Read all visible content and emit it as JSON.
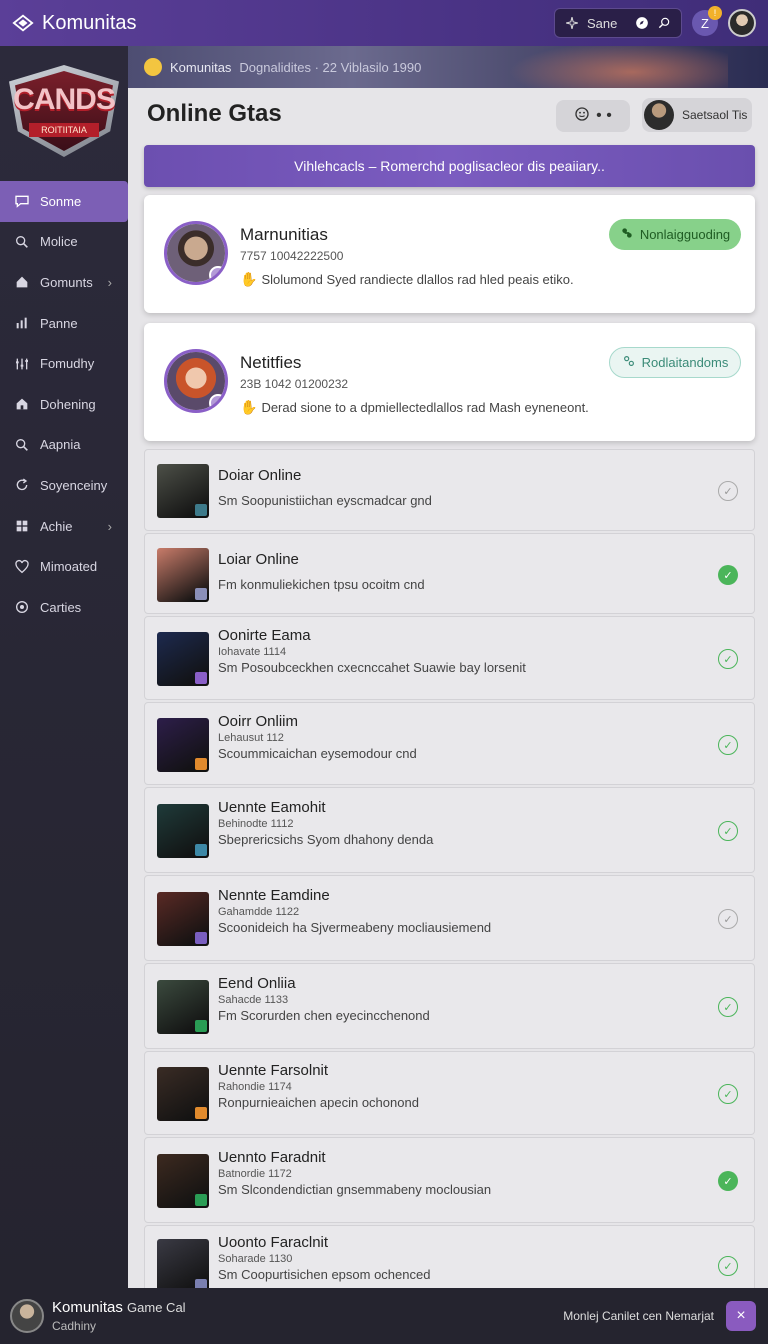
{
  "app": {
    "title": "Komunitas"
  },
  "topbar": {
    "search_label": "Sane",
    "notif_letter": "Z",
    "notif_count": "!"
  },
  "logo": {
    "text": "CANDS",
    "sub": "ROITIITAIA"
  },
  "sidebar": {
    "items": [
      {
        "label": "Sonme",
        "icon": "chat-bubble-icon",
        "active": true
      },
      {
        "label": "Molice",
        "icon": "search-icon"
      },
      {
        "label": "Gomunts",
        "icon": "home-icon",
        "chevron": true
      },
      {
        "label": "Panne",
        "icon": "bar-chart-icon"
      },
      {
        "label": "Fomudhy",
        "icon": "equalizer-icon"
      },
      {
        "label": "Dohening",
        "icon": "house-icon"
      },
      {
        "label": "Aapnia",
        "icon": "search-icon"
      },
      {
        "label": "Soyenceiny",
        "icon": "refresh-icon"
      },
      {
        "label": "Achie",
        "icon": "grid-icon",
        "chevron": true
      },
      {
        "label": "Mimoated",
        "icon": "heart-icon"
      },
      {
        "label": "Carties",
        "icon": "settings-icon"
      }
    ]
  },
  "banner": {
    "label": "Komunitas",
    "detail": "Dognalidites · 22 Viblasilo 1990"
  },
  "main": {
    "title": "Online Gtas",
    "head_pill": "• •",
    "user_pill": "Saetsaol Tis",
    "promo": "Vihlehcacls – Romerchd poglisacleor dis peaiiary.."
  },
  "featured": [
    {
      "name": "Marnunitias",
      "num": "7757 10042222500",
      "desc": "Slolumond Syed randiecte dlallos rad hled peais etiko.",
      "status": "Nonlaigguoding",
      "status_style": "green"
    },
    {
      "name": "Netitfies",
      "num": "23B 1042 01200232",
      "desc": "Derad sione to a dpmiellectedlallos rad Mash eyneneont.",
      "status": "Rodlaitandoms",
      "status_style": "outline"
    }
  ],
  "list": [
    {
      "title": "Doiar Online",
      "code": "",
      "desc": "Sm Soopunistiichan eyscmadcar gnd",
      "check": "pending",
      "thumb_color": "#4d5048",
      "mini": "#3d7a8a",
      "height": 82
    },
    {
      "title": "Loiar Online",
      "code": "",
      "desc": "Fm konmuliekichen tpsu ocoitm cnd",
      "check": "filled",
      "thumb_color": "#c97c6a",
      "mini": "#8a8fb8",
      "height": 81
    },
    {
      "title": "Oonirte Eama",
      "code": "Iohavate 1114",
      "desc": "Sm Posoubceckhen cxecnccahet  Suawie bay lorsenit",
      "check": "done",
      "thumb_color": "#1d2a4f",
      "mini": "#8a5fc7",
      "height": 84
    },
    {
      "title": "Ooirr Onliim",
      "code": "Lehausut 112",
      "desc": "Scoummicaichan eysemodour cnd",
      "check": "done",
      "thumb_color": "#2d1e4a",
      "mini": "#e08a2d",
      "height": 83
    },
    {
      "title": "Uennte Eamohit",
      "code": "Behinodte 1112",
      "desc": "Sbeprericsichs Syom dhahony denda",
      "check": "done",
      "thumb_color": "#1f3b3a",
      "mini": "#3d88a6",
      "height": 86
    },
    {
      "title": "Nennte Eamdine",
      "code": "Gahamdde 1122",
      "desc": "Scoonideich ha Sjvermeabeny mocliausiemend",
      "check": "pending",
      "thumb_color": "#5a2a25",
      "mini": "#7a5fc0",
      "height": 86
    },
    {
      "title": "Eend Onliia",
      "code": "Sahacde 1133",
      "desc": "Fm Scorurden chen eyecincchenond",
      "check": "done",
      "thumb_color": "#3b4a3e",
      "mini": "#2a9d55",
      "height": 86
    },
    {
      "title": "Uennte Farsolnit",
      "code": "Rahondie 1174",
      "desc": "Ronpurnieaichen apecin ochonond",
      "check": "done",
      "thumb_color": "#3a2c25",
      "mini": "#e08a2d",
      "height": 84
    },
    {
      "title": "Uennto Faradnit",
      "code": "Batnordie 1172",
      "desc": "Sm Slcondendictian gnsemmabeny moclousian",
      "check": "filled",
      "thumb_color": "#3d2a20",
      "mini": "#2a9d55",
      "height": 86
    },
    {
      "title": "Uoonto Faraclnit",
      "code": "Soharade 1130",
      "desc": "Sm Coopurtisichen epsom ochenced",
      "check": "done",
      "thumb_color": "#3a3a44",
      "mini": "#7a7fb0",
      "height": 80
    }
  ],
  "bottombar": {
    "name": "Komunitas",
    "name_suffix": "Game Cal",
    "sub": "Cadhiny",
    "right": "Monlej Canilet cen Nemarjat",
    "close": "×"
  },
  "colors": {
    "accent": "#7c5fb5",
    "topbar": "#5b3f98",
    "success": "#4bb55a"
  }
}
